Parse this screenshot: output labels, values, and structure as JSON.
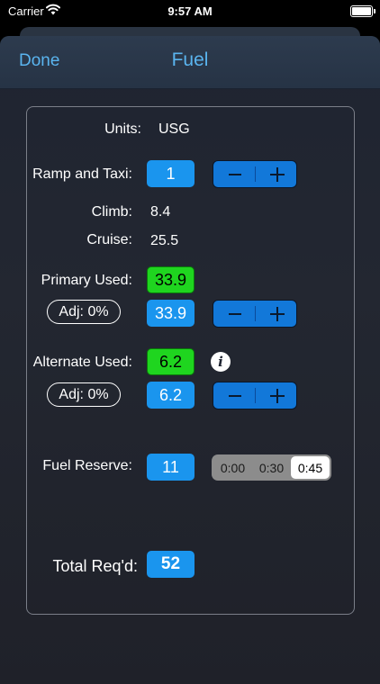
{
  "status_bar": {
    "carrier": "Carrier",
    "time": "9:57 AM"
  },
  "nav": {
    "done_label": "Done",
    "title": "Fuel"
  },
  "units": {
    "label": "Units:",
    "value": "USG"
  },
  "ramp_taxi": {
    "label": "Ramp and Taxi:",
    "value": "1"
  },
  "climb": {
    "label": "Climb:",
    "value": "8.4"
  },
  "cruise": {
    "label": "Cruise:",
    "value": "25.5"
  },
  "primary": {
    "label": "Primary Used:",
    "value": "33.9",
    "adj_label": "Adj:  0%",
    "adjusted_value": "33.9"
  },
  "alternate": {
    "label": "Alternate Used:",
    "value": "6.2",
    "adj_label": "Adj:  0%",
    "adjusted_value": "6.2",
    "info_icon": "i"
  },
  "reserve": {
    "label": "Fuel Reserve:",
    "value": "11",
    "options": [
      "0:00",
      "0:30",
      "0:45"
    ],
    "selected": "0:45"
  },
  "total": {
    "label": "Total Req'd:",
    "value": "52"
  },
  "colors": {
    "accent": "#5ab4ef",
    "value_blue": "#1a95ee",
    "value_green": "#1fd51f",
    "stepper": "#1278d9"
  }
}
